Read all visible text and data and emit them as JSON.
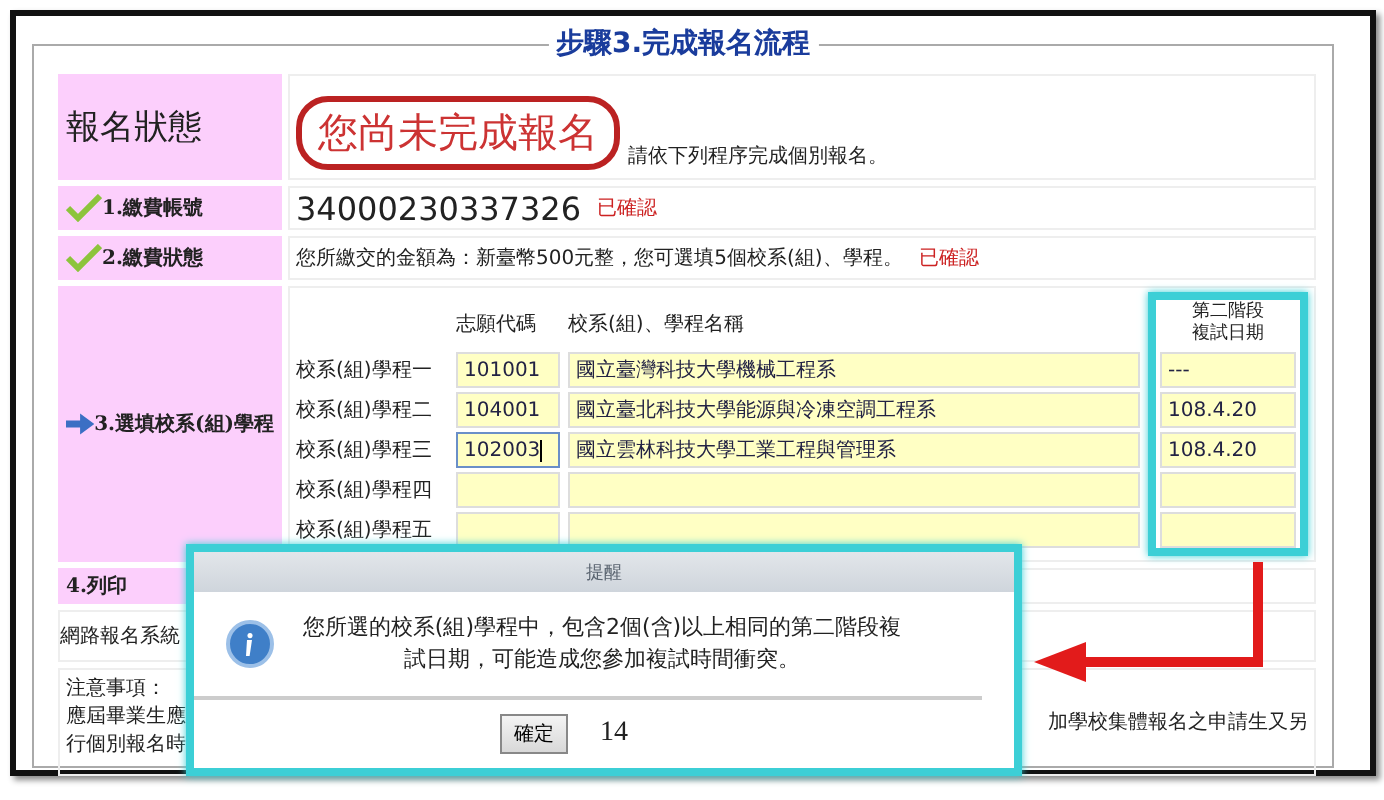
{
  "legend": "步驟3.完成報名流程",
  "status": {
    "label": "報名狀態",
    "headline": "您尚未完成報名",
    "note": "請依下列程序完成個別報名。"
  },
  "steps": [
    {
      "kind": "check",
      "label": "1.繳費帳號",
      "value": "34000230337326",
      "confirmed": "已確認",
      "big": true
    },
    {
      "kind": "check",
      "label": "2.繳費狀態",
      "value": "您所繳交的金額為：新臺幣500元整，您可選填5個校系(組)、學程。",
      "confirmed": "已確認",
      "big": false
    }
  ],
  "choices": {
    "kind": "arrow",
    "label": "3.選填校系(組)學程",
    "code_header": "志願代碼",
    "name_header": "校系(組)、學程名稱",
    "date_header": [
      "第二階段",
      "複試日期"
    ],
    "rows": [
      {
        "label": "校系(組)學程一",
        "code": "101001",
        "name": "國立臺灣科技大學機械工程系",
        "date": "---",
        "focused": false
      },
      {
        "label": "校系(組)學程二",
        "code": "104001",
        "name": "國立臺北科技大學能源與冷凍空調工程系",
        "date": "108.4.20",
        "focused": false
      },
      {
        "label": "校系(組)學程三",
        "code": "102003",
        "name": "國立雲林科技大學工業工程與管理系",
        "date": "108.4.20",
        "focused": true
      },
      {
        "label": "校系(組)學程四",
        "code": "",
        "name": "",
        "date": "",
        "focused": false
      },
      {
        "label": "校系(組)學程五",
        "code": "",
        "name": "",
        "date": "",
        "focused": false
      }
    ]
  },
  "print": {
    "label": "4.列印",
    "text": "網路報名系統"
  },
  "notes": {
    "lines": [
      "注意事項：",
      "應屆畢業生應",
      "行個別報名時"
    ],
    "right_text": "加學校集體報名之申請生又另"
  },
  "dialog": {
    "title": "提醒",
    "message": "您所選的校系(組)學程中，包含2個(含)以上相同的第二階段複試日期，可能造成您參加複試時間衝突。",
    "button": "確定",
    "counter": "14"
  }
}
